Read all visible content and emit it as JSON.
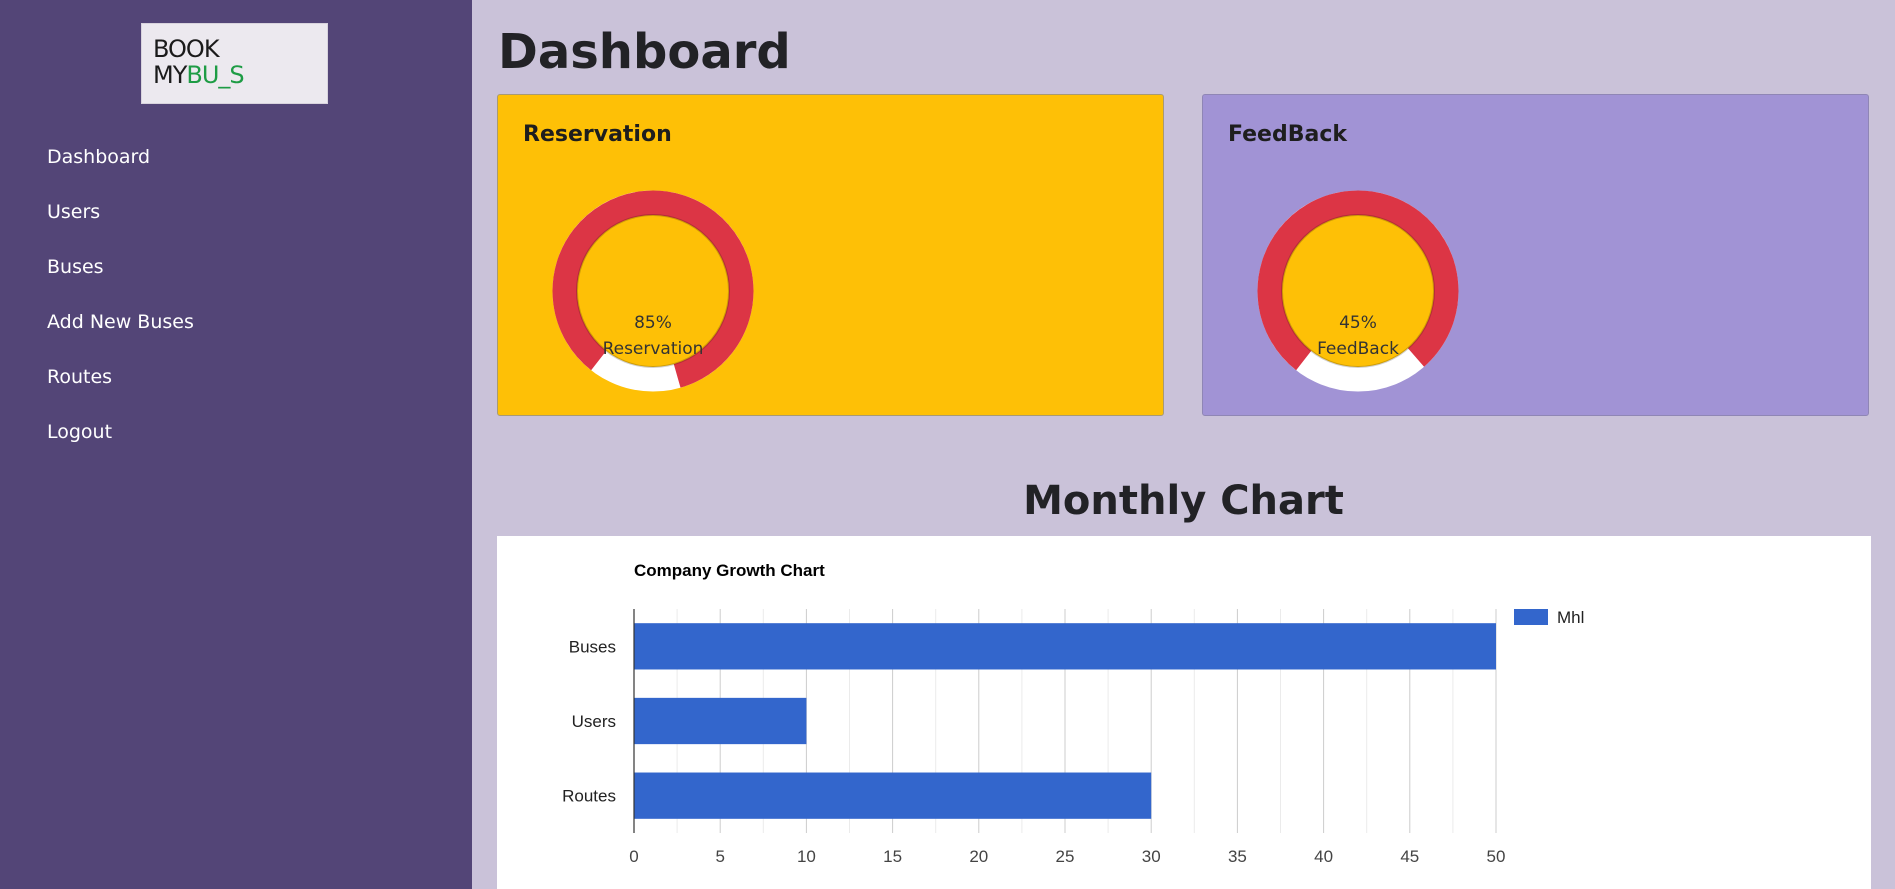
{
  "logo": {
    "line1": "BOOK",
    "line2_start": "MY",
    "line2_mark": "BU",
    "line2_mid": "_",
    "line2_end": "S"
  },
  "sidebar": {
    "items": [
      {
        "label": "Dashboard"
      },
      {
        "label": "Users"
      },
      {
        "label": "Buses"
      },
      {
        "label": "Add New Buses"
      },
      {
        "label": "Routes"
      },
      {
        "label": "Logout"
      }
    ]
  },
  "page": {
    "title": "Dashboard"
  },
  "cards": {
    "reservation": {
      "title": "Reservation",
      "percent_text": "85%",
      "label": "Reservation",
      "percent": 85,
      "ring_color": "#dc3545",
      "track_color": "#ffffff",
      "inner_color": "#fec006",
      "bg_color": "#fec006"
    },
    "feedback": {
      "title": "FeedBack",
      "percent_text": "45%",
      "label": "FeedBack",
      "percent": 45,
      "ring_color": "#dc3545",
      "track_color": "#ffffff",
      "inner_color": "#fec006",
      "bg_color": "#a193d5"
    }
  },
  "monthly": {
    "heading": "Monthly Chart"
  },
  "chart_data": {
    "type": "bar",
    "orientation": "horizontal",
    "title": "Company Growth Chart",
    "categories": [
      "Buses",
      "Users",
      "Routes"
    ],
    "series": [
      {
        "name": "Mhl",
        "values": [
          50,
          10,
          30
        ],
        "color": "#3366cc"
      }
    ],
    "xlim": [
      0,
      50
    ],
    "xticks": [
      0,
      5,
      10,
      15,
      20,
      25,
      30,
      35,
      40,
      45,
      50
    ],
    "grid": true,
    "legend": "top-right"
  }
}
